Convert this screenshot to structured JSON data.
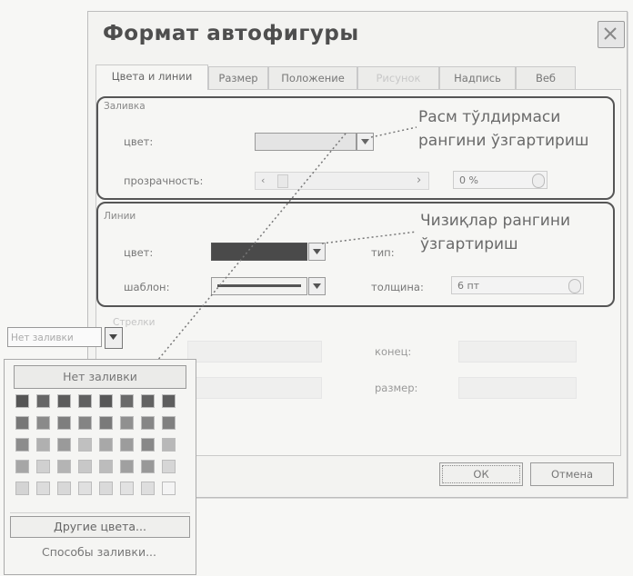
{
  "dialog": {
    "title": "Формат автофигуры",
    "tabs": [
      "Цвета и линии",
      "Размер",
      "Положение",
      "Рисунок",
      "Надпись",
      "Веб"
    ],
    "fill": {
      "section": "Заливка",
      "color_label": "цвет:",
      "transparency_label": "прозрачность:",
      "transparency_value": "0 %"
    },
    "line": {
      "section": "Линии",
      "color_label": "цвет:",
      "type_label": "тип:",
      "pattern_label": "шаблон:",
      "weight_label": "толщина:",
      "weight_value": "6 пт"
    },
    "arrows": {
      "section": "Стрелки",
      "end_label": "конец:",
      "size_label": "размер:"
    },
    "ok_label": "ОК",
    "cancel_label": "Отмена"
  },
  "annotations": {
    "fill_note_line1": "Расм тўлдирмаси",
    "fill_note_line2": "рангини ўзгартириш",
    "line_note_line1": "Чизиқлар рангини",
    "line_note_line2": "ўзгартириш"
  },
  "palette": {
    "combo_value": "Нет заливки",
    "no_fill_label": "Нет заливки",
    "more_colors_label": "Другие цвета...",
    "fill_effects_label": "Способы заливки...",
    "rows": [
      [
        "#555555",
        "#666666",
        "#5c5c5c",
        "#606060",
        "#585858",
        "#6a6a6a",
        "#626262",
        "#5e5e5e"
      ],
      [
        "#777777",
        "#8a8a8a",
        "#7e7e7e",
        "#848484",
        "#7a7a7a",
        "#909090",
        "#868686",
        "#808080"
      ],
      [
        "#8c8c8c",
        "#b0b0b0",
        "#9a9a9a",
        "#c0c0c0",
        "#a8a8a8",
        "#9c9c9c",
        "#888888",
        "#b8b8b8"
      ],
      [
        "#a6a6a6",
        "#d0d0d0",
        "#b4b4b4",
        "#c8c8c8",
        "#bcbcbc",
        "#a0a0a0",
        "#989898",
        "#d6d6d6"
      ],
      [
        "#d4d4d4",
        "#dcdcdc",
        "#d8d8d8",
        "#e0e0e0",
        "#dadada",
        "#e2e2e2",
        "#dedede",
        "#f4f4f4"
      ]
    ]
  }
}
